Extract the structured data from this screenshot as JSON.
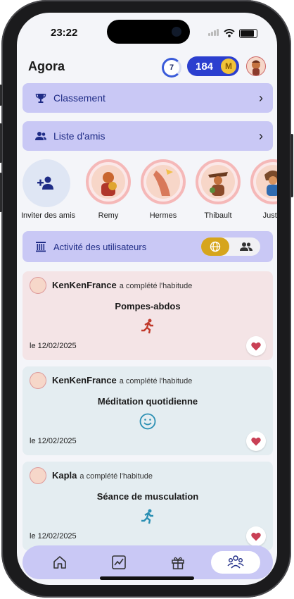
{
  "status": {
    "time": "23:22"
  },
  "header": {
    "title": "Agora",
    "streak": "7",
    "coins": "184",
    "coin_symbol": "M"
  },
  "menu": {
    "ranking_label": "Classement",
    "friends_list_label": "Liste d'amis"
  },
  "friends": {
    "invite_label": "Inviter des amis",
    "items": [
      {
        "name": "Remy"
      },
      {
        "name": "Hermes"
      },
      {
        "name": "Thibault"
      },
      {
        "name": "Justin"
      }
    ]
  },
  "activity": {
    "title": "Activité des utilisateurs"
  },
  "feed": [
    {
      "user": "KenKenFrance",
      "action": "a complété l'habitude",
      "habit": "Pompes-abdos",
      "date": "le 12/02/2025",
      "icon": "running-icon",
      "bg": "#f4e4e6",
      "icon_color": "#c0392b"
    },
    {
      "user": "KenKenFrance",
      "action": "a complété l'habitude",
      "habit": "Méditation quotidienne",
      "date": "le 12/02/2025",
      "icon": "smile-icon",
      "bg": "#e4edf1",
      "icon_color": "#2a8fb3"
    },
    {
      "user": "Kapla",
      "action": "a complété l'habitude",
      "habit": "Séance de musculation",
      "date": "le 12/02/2025",
      "icon": "running-icon",
      "bg": "#e4edf1",
      "icon_color": "#2a8fb3"
    }
  ],
  "colors": {
    "accent": "#c9c8f5",
    "navy": "#1f2c86",
    "coin_pill": "#2b3fcf",
    "toggle_active": "#d6a51c",
    "heart": "#c94055"
  }
}
